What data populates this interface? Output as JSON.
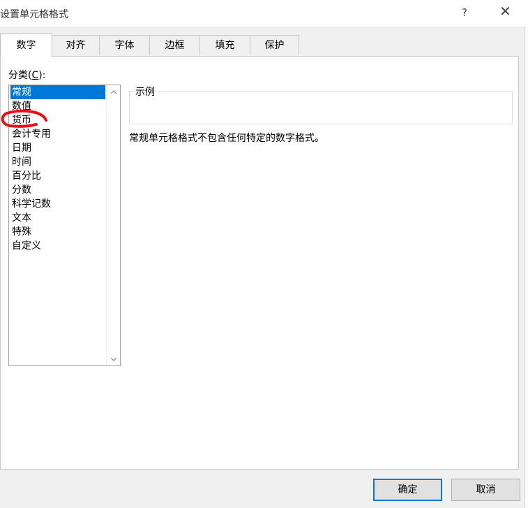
{
  "window": {
    "title": "设置单元格格式",
    "help": "?",
    "close": "✕"
  },
  "tabs": [
    {
      "label": "数字",
      "active": true
    },
    {
      "label": "对齐"
    },
    {
      "label": "字体"
    },
    {
      "label": "边框"
    },
    {
      "label": "填充"
    },
    {
      "label": "保护"
    }
  ],
  "category": {
    "label_prefix": "分类(",
    "label_key": "C",
    "label_suffix": "):",
    "items": [
      "常规",
      "数值",
      "货币",
      "会计专用",
      "日期",
      "时间",
      "百分比",
      "分数",
      "科学记数",
      "文本",
      "特殊",
      "自定义"
    ],
    "selected": "常规"
  },
  "sample": {
    "legend": "示例"
  },
  "description": "常规单元格格式不包含任何特定的数字格式。",
  "buttons": {
    "ok": "确定",
    "cancel": "取消"
  },
  "colors": {
    "accent": "#0078d7",
    "annotation": "#e8101a"
  }
}
